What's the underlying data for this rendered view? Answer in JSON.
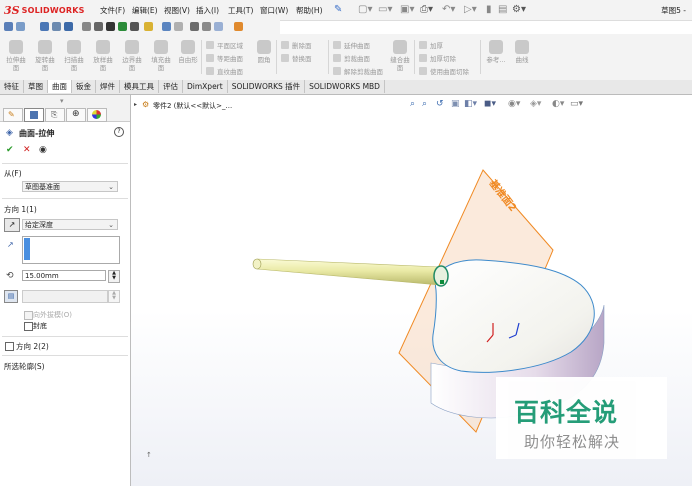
{
  "app": {
    "logo_prefix": "3S",
    "logo_text": "SOLIDWORKS",
    "doc_name": "草图5 -"
  },
  "menu": [
    "文件(F)",
    "编辑(E)",
    "视图(V)",
    "插入(I)",
    "工具(T)",
    "窗口(W)",
    "帮助(H)"
  ],
  "command_manager": {
    "tools": [
      "拉伸曲面",
      "旋转曲面",
      "扫描曲面",
      "放样曲面",
      "边界曲面",
      "填充曲面",
      "自由形"
    ],
    "surface_group": [
      "平面区域",
      "等距曲面",
      "直纹曲面"
    ],
    "fillet": "圆角",
    "delete_group": [
      "删除面",
      "替换面"
    ],
    "extend_group": [
      "延伸曲面",
      "剪裁曲面",
      "解除剪裁曲面"
    ],
    "knit": "缝合曲面",
    "thicken_group": [
      "加厚",
      "加厚切除",
      "使用曲面切除"
    ],
    "reference": "参考...",
    "curves": "曲线"
  },
  "tabs": [
    "特征",
    "草图",
    "曲面",
    "钣金",
    "焊件",
    "模具工具",
    "评估",
    "DimXpert",
    "SOLIDWORKS 插件",
    "SOLIDWORKS MBD"
  ],
  "active_tab": "曲面",
  "feature_tree": {
    "part_label": "零件2 (默认<<默认>_..."
  },
  "property_manager": {
    "title": "曲面-拉伸",
    "from_label": "从(F)",
    "from_value": "草图基准面",
    "direction1_label": "方向 1(1)",
    "end_condition": "给定深度",
    "depth": "15.00mm",
    "draft_outward": "向外拔模(O)",
    "cap_end": "封底",
    "direction2_label": "方向 2(2)",
    "selected_contours": "所选轮廓(S)"
  },
  "viewport": {
    "plane_label": "基准面2"
  },
  "watermark": {
    "title": "百科全说",
    "subtitle": "助你轻松解决"
  }
}
